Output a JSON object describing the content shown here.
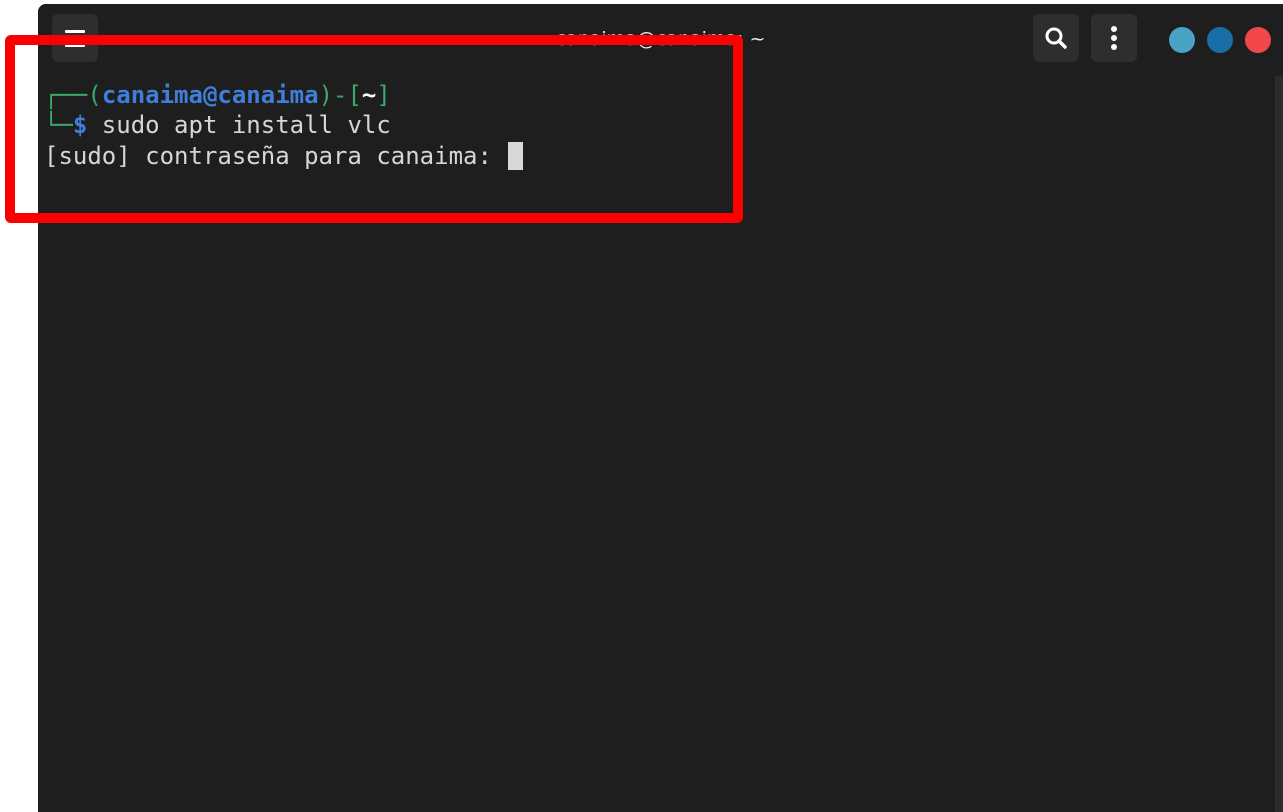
{
  "window": {
    "title": "canaima@canaima: ~",
    "controls": {
      "minimize_color": "#4aa3c3",
      "maximize_color": "#1a6ea6",
      "close_color": "#f3484b"
    },
    "icons": {
      "menu": "hamburger-menu-icon",
      "search": "search-icon",
      "more": "vertical-dots-icon"
    }
  },
  "terminal": {
    "prompt": {
      "corner_top": "┌──",
      "open_paren": "(",
      "user_host": "canaima@canaima",
      "close_paren": ")",
      "dash": "-",
      "open_bracket": "[",
      "cwd": "~",
      "close_bracket": "]",
      "corner_bottom": "└─",
      "symbol": "$"
    },
    "command": " sudo apt install vlc",
    "output_line": "[sudo] contraseña para canaima: "
  },
  "colors": {
    "prompt_green": "#3aa86b",
    "prompt_blue": "#3f7fd9",
    "annotation_red": "#fb0000"
  }
}
